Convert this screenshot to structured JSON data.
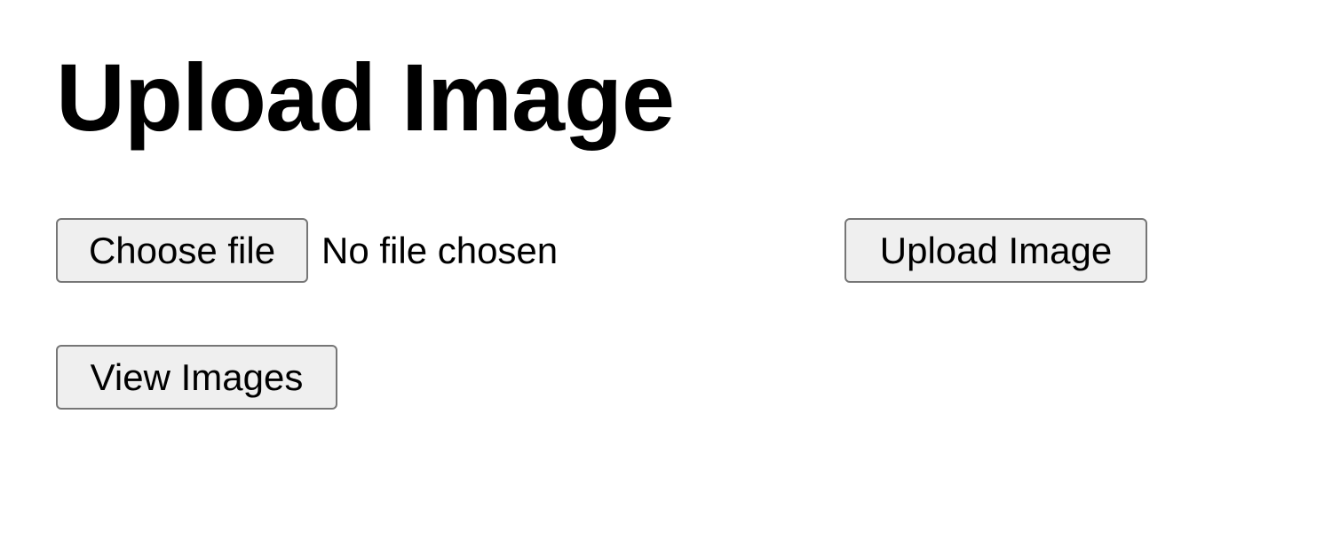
{
  "page": {
    "title": "Upload Image"
  },
  "file_input": {
    "button_label": "Choose file",
    "status_text": "No file chosen"
  },
  "actions": {
    "upload_label": "Upload Image",
    "view_label": "View Images"
  }
}
